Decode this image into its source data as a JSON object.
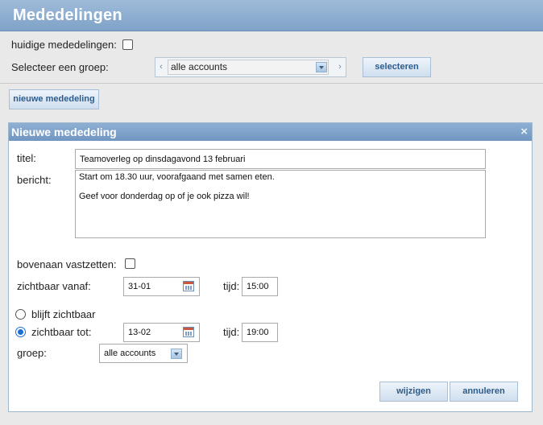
{
  "page": {
    "title": "Mededelingen"
  },
  "filters": {
    "current_label": "huidige mededelingen:",
    "group_label": "Selecteer een groep:",
    "group_prev": "‹",
    "group_next": "›",
    "group_value": "alle accounts",
    "select_button": "selecteren"
  },
  "new_button": "nieuwe mededeling",
  "dialog": {
    "title": "Nieuwe mededeling",
    "close": "×",
    "title_label": "titel:",
    "title_value": "Teamoverleg op dinsdagavond 13 februari",
    "message_label": "bericht:",
    "message_value": "Start om 18.30 uur, voorafgaand met samen eten.\n\nGeef voor donderdag op of je ook pizza wil!",
    "pin_label": "bovenaan vastzetten:",
    "visible_from_label": "zichtbaar vanaf:",
    "visible_from_date": "31-01",
    "time_label": "tijd:",
    "visible_from_time": "15:00",
    "stays_visible_label": "blijft zichtbaar",
    "visible_until_label": "zichtbaar tot:",
    "visible_until_date": "13-02",
    "visible_until_time": "19:00",
    "group_label": "groep:",
    "group_value": "alle accounts",
    "save_button": "wijzigen",
    "cancel_button": "annuleren"
  },
  "colors": {
    "header": "#8aabd0",
    "accent": "#2d5c8c",
    "radio_selected": "#1a6fd6"
  }
}
